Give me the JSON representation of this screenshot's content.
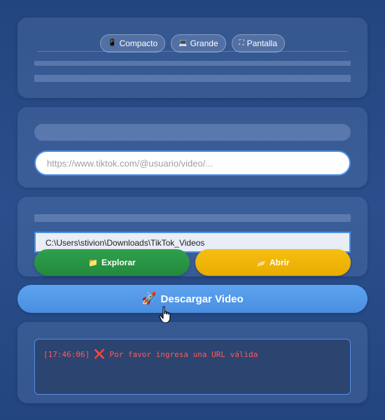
{
  "view_modes": [
    {
      "icon": "📱",
      "label": "Compacto"
    },
    {
      "icon": "💻",
      "label": "Grande"
    },
    {
      "icon": "⛶",
      "label": "Pantalla"
    }
  ],
  "url_input": {
    "value": "",
    "placeholder": "https://www.tiktok.com/@usuario/video/..."
  },
  "folder": {
    "path": "C:\\Users\\stivion\\Downloads\\TikTok_Videos",
    "explore_icon": "📁",
    "explore_label": "Explorar",
    "open_icon": "📂",
    "open_label": "Abrir"
  },
  "download": {
    "icon": "🚀",
    "label": "Descargar Video"
  },
  "log": {
    "timestamp": "[17:46:06]",
    "icon": "❌",
    "message": "Por favor ingresa una URL válida"
  },
  "colors": {
    "accent": "#4a90e2",
    "explore": "#2a9a48",
    "open": "#f2b705",
    "error": "#ff5a5a"
  }
}
